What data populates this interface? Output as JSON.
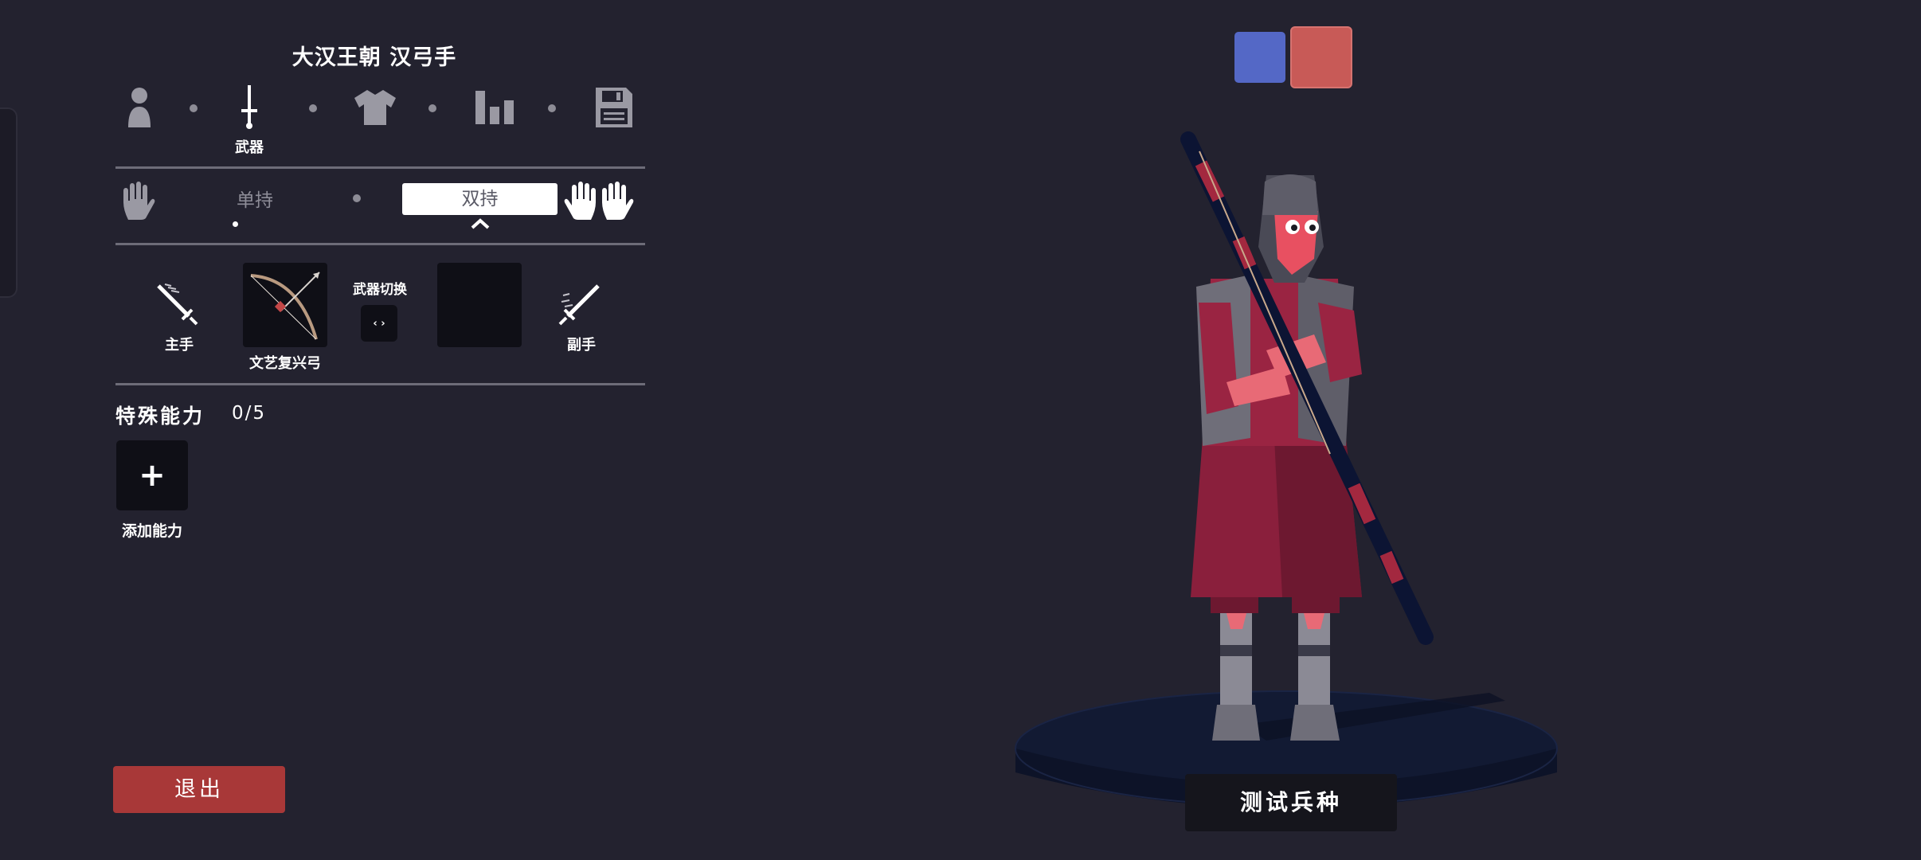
{
  "unit_name": "大汉王朝 汉弓手",
  "steps": {
    "active_label": "武器",
    "icons": [
      "person-icon",
      "sword-icon",
      "shirt-icon",
      "stats-icon",
      "save-icon"
    ]
  },
  "hold_mode": {
    "single_label": "单持",
    "dual_label": "双持",
    "selected": "双持"
  },
  "weapons": {
    "main_hand_label": "主手",
    "main_weapon_name": "文艺复兴弓",
    "switch_label": "武器切换",
    "switch_glyph": "‹ ›",
    "off_hand_label": "副手"
  },
  "abilities": {
    "title": "特殊能力",
    "count": "0/5",
    "add_glyph": "+",
    "add_label": "添加能力"
  },
  "exit_label": "退出",
  "test_label": "测试兵种",
  "colors": {
    "background": "#23222f",
    "team_blue": "#5468c6",
    "team_red": "#c85a57",
    "exit_button": "#a83838"
  }
}
